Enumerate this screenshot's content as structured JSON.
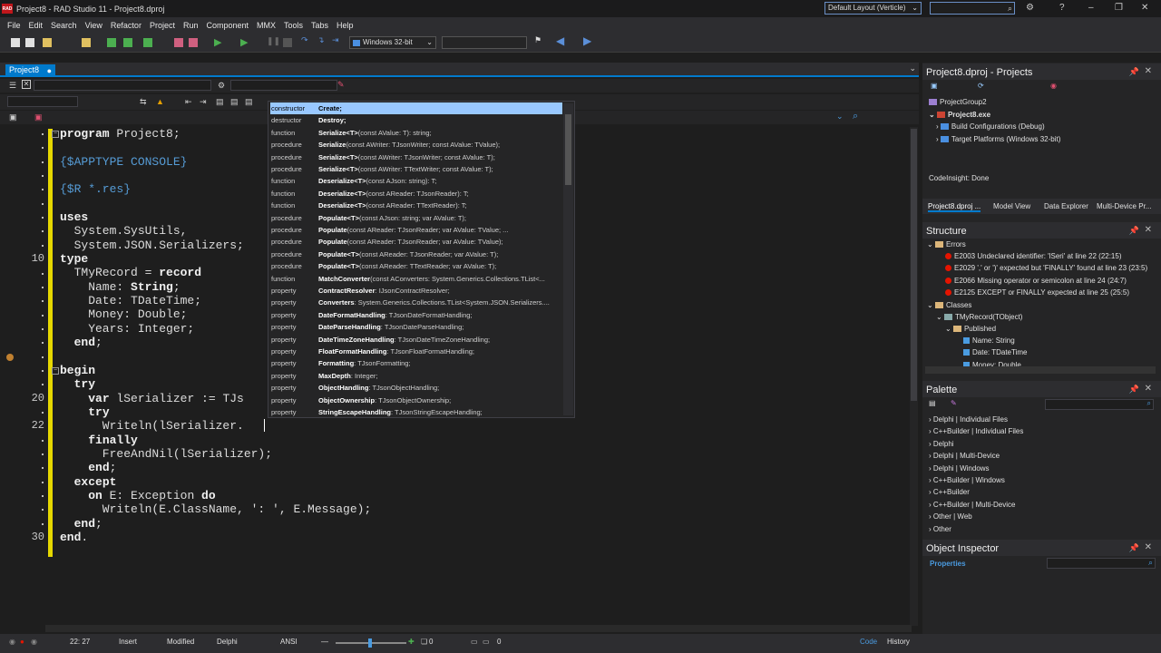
{
  "titlebar": {
    "title": "Project8 - RAD Studio 11 - Project8.dproj",
    "app_badge": "RAD",
    "layout": "Default Layout (Verticle)"
  },
  "menu": [
    "File",
    "Edit",
    "Search",
    "View",
    "Refactor",
    "Project",
    "Run",
    "Component",
    "MMX",
    "Tools",
    "Tabs",
    "Help"
  ],
  "toolbar": {
    "platform": "Windows 32-bit"
  },
  "editor": {
    "tab": "Project8",
    "line_numbers": [
      {
        "n": "10",
        "line": 9
      },
      {
        "n": "20",
        "line": 19
      },
      {
        "n": "22",
        "line": 21
      },
      {
        "n": "30",
        "line": 29
      }
    ],
    "lines": [
      [
        [
          "kw",
          "program"
        ],
        [
          "t",
          " Project8;"
        ]
      ],
      [
        [
          "t",
          ""
        ]
      ],
      [
        [
          "dir",
          "{$APPTYPE CONSOLE}"
        ]
      ],
      [
        [
          "t",
          ""
        ]
      ],
      [
        [
          "dir",
          "{$R *.res}"
        ]
      ],
      [
        [
          "t",
          ""
        ]
      ],
      [
        [
          "kw",
          "uses"
        ]
      ],
      [
        [
          "t",
          "  System.SysUtils,"
        ]
      ],
      [
        [
          "t",
          "  System.JSON.Serializers;"
        ]
      ],
      [
        [
          "kw",
          "type"
        ]
      ],
      [
        [
          "t",
          "  TMyRecord = "
        ],
        [
          "kw",
          "record"
        ]
      ],
      [
        [
          "t",
          "    Name: "
        ],
        [
          "kw",
          "String"
        ],
        [
          "t",
          ";"
        ]
      ],
      [
        [
          "t",
          "    Date: TDateTime;"
        ]
      ],
      [
        [
          "t",
          "    Money: Double;"
        ]
      ],
      [
        [
          "t",
          "    Years: Integer;"
        ]
      ],
      [
        [
          "t",
          "  "
        ],
        [
          "kw",
          "end"
        ],
        [
          "t",
          ";"
        ]
      ],
      [
        [
          "t",
          ""
        ]
      ],
      [
        [
          "kw",
          "begin"
        ]
      ],
      [
        [
          "t",
          "  "
        ],
        [
          "kw",
          "try"
        ]
      ],
      [
        [
          "t",
          "    "
        ],
        [
          "kw",
          "var"
        ],
        [
          "t",
          " lSerializer := TJs"
        ]
      ],
      [
        [
          "t",
          "    "
        ],
        [
          "kw",
          "try"
        ]
      ],
      [
        [
          "t",
          "      Writeln(lSerializer."
        ]
      ],
      [
        [
          "t",
          "    "
        ],
        [
          "kw",
          "finally"
        ]
      ],
      [
        [
          "t",
          "      FreeAndNil(lSerializer);"
        ]
      ],
      [
        [
          "t",
          "    "
        ],
        [
          "kw",
          "end"
        ],
        [
          "t",
          ";"
        ]
      ],
      [
        [
          "t",
          "  "
        ],
        [
          "kw",
          "except"
        ]
      ],
      [
        [
          "t",
          "    "
        ],
        [
          "kw",
          "on"
        ],
        [
          "t",
          " E: Exception "
        ],
        [
          "kw",
          "do"
        ]
      ],
      [
        [
          "t",
          "      Writeln(E.ClassName, ': ', E.Message);"
        ]
      ],
      [
        [
          "t",
          "  "
        ],
        [
          "kw",
          "end"
        ],
        [
          "t",
          ";"
        ]
      ],
      [
        [
          "kw",
          "end"
        ],
        [
          "t",
          "."
        ]
      ]
    ]
  },
  "completion": [
    {
      "kind": "constructor",
      "name": "Create;",
      "detail": ""
    },
    {
      "kind": "destructor",
      "name": "Destroy;",
      "detail": ""
    },
    {
      "kind": "function",
      "name": "Serialize<T>",
      "detail": "(const AValue: T): string;"
    },
    {
      "kind": "procedure",
      "name": "Serialize",
      "detail": "(const AWriter: TJsonWriter; const AValue: TValue);"
    },
    {
      "kind": "procedure",
      "name": "Serialize<T>",
      "detail": "(const AWriter: TJsonWriter; const AValue: T);"
    },
    {
      "kind": "procedure",
      "name": "Serialize<T>",
      "detail": "(const AWriter: TTextWriter; const AValue: T);"
    },
    {
      "kind": "function",
      "name": "Deserialize<T>",
      "detail": "(const AJson: string): T;"
    },
    {
      "kind": "function",
      "name": "Deserialize<T>",
      "detail": "(const AReader: TJsonReader): T;"
    },
    {
      "kind": "function",
      "name": "Deserialize<T>",
      "detail": "(const AReader: TTextReader): T;"
    },
    {
      "kind": "procedure",
      "name": "Populate<T>",
      "detail": "(const AJson: string; var AValue: T);"
    },
    {
      "kind": "procedure",
      "name": "Populate",
      "detail": "(const AReader: TJsonReader; var AValue: TValue; ..."
    },
    {
      "kind": "procedure",
      "name": "Populate",
      "detail": "(const AReader: TJsonReader; var AValue: TValue);"
    },
    {
      "kind": "procedure",
      "name": "Populate<T>",
      "detail": "(const AReader: TJsonReader; var AValue: T);"
    },
    {
      "kind": "procedure",
      "name": "Populate<T>",
      "detail": "(const AReader: TTextReader; var AValue: T);"
    },
    {
      "kind": "function",
      "name": "MatchConverter",
      "detail": "(const AConverters: System.Generics.Collections.TList<..."
    },
    {
      "kind": "property",
      "name": "ContractResolver",
      "detail": ": IJsonContractResolver;"
    },
    {
      "kind": "property",
      "name": "Converters",
      "detail": ": System.Generics.Collections.TList<System.JSON.Serializers...."
    },
    {
      "kind": "property",
      "name": "DateFormatHandling",
      "detail": ": TJsonDateFormatHandling;"
    },
    {
      "kind": "property",
      "name": "DateParseHandling",
      "detail": ": TJsonDateParseHandling;"
    },
    {
      "kind": "property",
      "name": "DateTimeZoneHandling",
      "detail": ": TJsonDateTimeZoneHandling;"
    },
    {
      "kind": "property",
      "name": "FloatFormatHandling",
      "detail": ": TJsonFloatFormatHandling;"
    },
    {
      "kind": "property",
      "name": "Formatting",
      "detail": ": TJsonFormatting;"
    },
    {
      "kind": "property",
      "name": "MaxDepth",
      "detail": ": Integer;"
    },
    {
      "kind": "property",
      "name": "ObjectHandling",
      "detail": ": TJsonObjectHandling;"
    },
    {
      "kind": "property",
      "name": "ObjectOwnership",
      "detail": ": TJsonObjectOwnership;"
    },
    {
      "kind": "property",
      "name": "StringEscapeHandling",
      "detail": ": TJsonStringEscapeHandling;"
    }
  ],
  "projects": {
    "title": "Project8.dproj - Projects",
    "items": [
      "ProjectGroup2",
      "Project8.exe",
      "Build Configurations (Debug)",
      "Target Platforms (Windows 32-bit)"
    ],
    "status": "CodeInsight: Done",
    "tabs": [
      "Project8.dproj ...",
      "Model View",
      "Data Explorer",
      "Multi-Device Pr..."
    ]
  },
  "structure": {
    "title": "Structure",
    "errors_label": "Errors",
    "errors": [
      "E2003 Undeclared identifier: 'lSeri' at line 22 (22:15)",
      "E2029 ',' or ')' expected but 'FINALLY' found at line 23 (23:5)",
      "E2066 Missing operator or semicolon at line 24 (24:7)",
      "E2125 EXCEPT or FINALLY expected at line 25 (25:5)"
    ],
    "classes_label": "Classes",
    "record": "TMyRecord(TObject)",
    "published": "Published",
    "fields": [
      "Name: String",
      "Date: TDateTime",
      "Money: Double"
    ]
  },
  "palette": {
    "title": "Palette",
    "items": [
      "Delphi | Individual Files",
      "C++Builder | Individual Files",
      "Delphi",
      "Delphi | Multi-Device",
      "Delphi | Windows",
      "C++Builder | Windows",
      "C++Builder",
      "C++Builder | Multi-Device",
      "Other | Web",
      "Other"
    ]
  },
  "inspector": {
    "title": "Object Inspector",
    "tab": "Properties"
  },
  "status": {
    "position": "22: 27",
    "mode": "Insert",
    "modified": "Modified",
    "lang": "Delphi",
    "encoding": "ANSI",
    "zero1": "0",
    "zero2": "0",
    "code_tab": "Code",
    "history_tab": "History"
  }
}
